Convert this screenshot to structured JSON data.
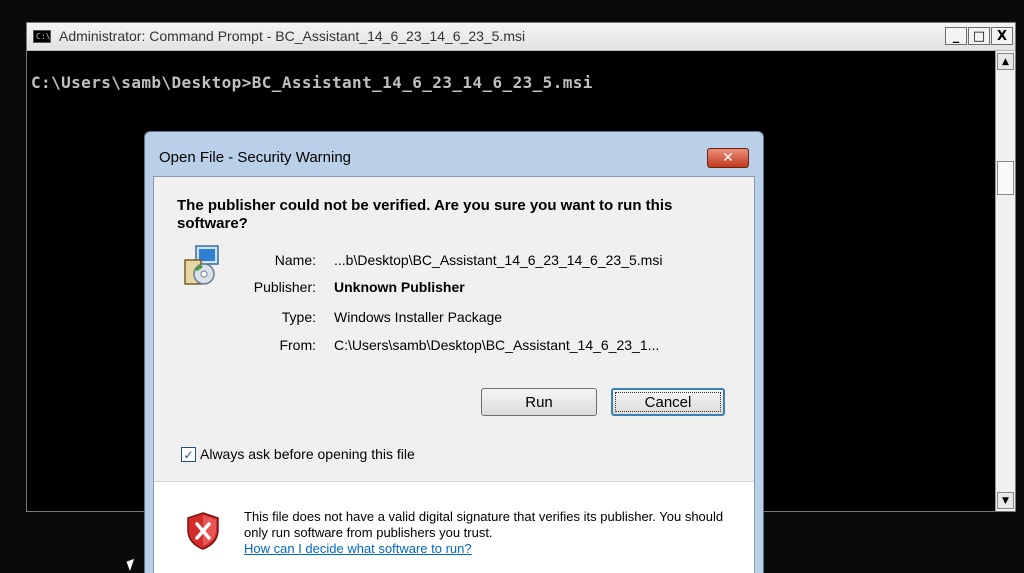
{
  "console": {
    "title": "Administrator: Command Prompt - BC_Assistant_14_6_23_14_6_23_5.msi",
    "command_line": "C:\\Users\\samb\\Desktop>BC_Assistant_14_6_23_14_6_23_5.msi",
    "buttons": {
      "minimize": "_",
      "maximize": "□",
      "close": "X"
    }
  },
  "dialog": {
    "title": "Open File - Security Warning",
    "question": "The publisher could not be verified.  Are you sure you want to run this software?",
    "fields": {
      "name_label": "Name:",
      "name_value": "...b\\Desktop\\BC_Assistant_14_6_23_14_6_23_5.msi",
      "publisher_label": "Publisher:",
      "publisher_value": "Unknown Publisher",
      "type_label": "Type:",
      "type_value": "Windows Installer Package",
      "from_label": "From:",
      "from_value": "C:\\Users\\samb\\Desktop\\BC_Assistant_14_6_23_1..."
    },
    "buttons": {
      "run": "Run",
      "cancel": "Cancel"
    },
    "checkbox": {
      "label": "Always ask before opening this file",
      "checked": true
    },
    "warning": {
      "text": "This file does not have a valid digital signature that verifies its publisher.  You should only run software from publishers you trust.",
      "link": "How can I decide what software to run?"
    }
  },
  "icons": {
    "console": "console-window-icon",
    "installer": "installer-package-icon",
    "shield": "security-shield-icon"
  },
  "colors": {
    "dialog_frame": "#b9d0e8",
    "close_button": "#c2391e",
    "link": "#0066cc",
    "console_bg": "#000000",
    "console_text": "#c0c0c0"
  }
}
